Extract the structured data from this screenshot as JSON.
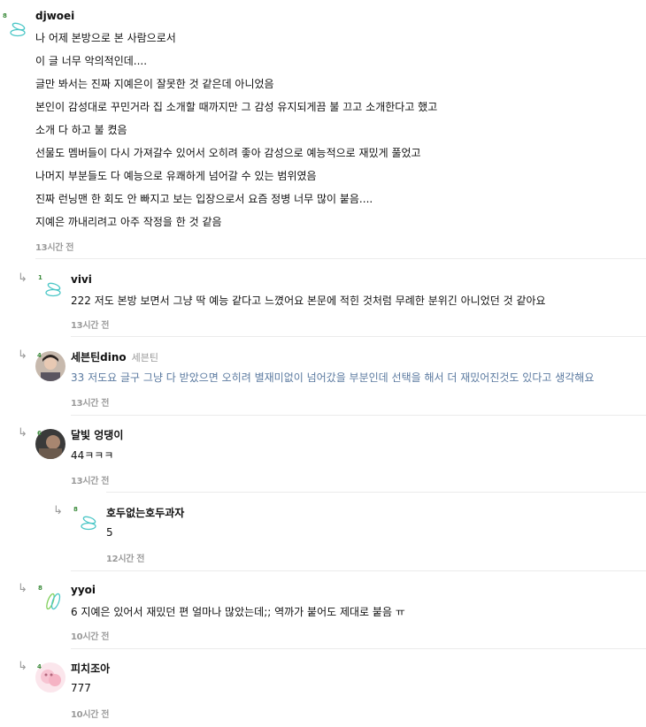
{
  "comments": [
    {
      "nickname": "djwoei",
      "level": "8",
      "lines": [
        "나 어제 본방으로 본 사람으로서",
        "이 글 너무 악의적인데....",
        "글만 봐서는 진짜 지예은이 잘못한 것 같은데 아니었음",
        "본인이 감성대로 꾸민거라 집 소개할 때까지만 그 감성 유지되게끔 불 끄고 소개한다고 했고",
        "소개 다 하고 불 켰음",
        "선물도 멤버들이 다시 가져갈수 있어서 오히려 좋아 감성으로 예능적으로 재밌게 풀었고",
        "나머지 부분들도 다 예능으로 유쾌하게 넘어갈 수 있는 범위였음",
        "진짜 런닝맨 한 회도 안 빠지고 보는 입장으로서 요즘 정병 너무 많이 붙음....",
        "지예은 까내리려고 아주 작정을 한 것 같음"
      ],
      "time": "13시간 전"
    },
    {
      "nickname": "vivi",
      "level": "1",
      "text": "222 저도 본방 보면서 그냥 딱 예능 같다고 느꼈어요 본문에 적힌 것처럼 무례한 분위긴 아니었던 것 같아요",
      "time": "13시간 전"
    },
    {
      "nickname": "세븐틴dino",
      "sub_label": "세븐틴",
      "level": "4",
      "text": "33 저도요 글구 그냥 다 받았으면 오히려 별재미없이 넘어갔을 부분인데 선택을 해서 더 재밌어진것도 있다고 생각해요",
      "time": "13시간 전"
    },
    {
      "nickname": "달빛 엉댕이",
      "level": "6",
      "text": "44ㅋㅋㅋ",
      "time": "13시간 전"
    },
    {
      "nickname": "호두없는호두과자",
      "level": "8",
      "text": "5",
      "time": "12시간 전"
    },
    {
      "nickname": "yyoi",
      "level": "8",
      "text": "6 지예은 있어서 재밌던 편 얼마나 많았는데;; 역까가 붙어도 제대로 붙음 ㅠ",
      "time": "10시간 전"
    },
    {
      "nickname": "피치조아",
      "level": "4",
      "text": "777",
      "time": "10시간 전"
    }
  ],
  "icons": {
    "reply_arrow": "reply-arrow-icon",
    "default_avatar": "default-avatar-icon"
  },
  "colors": {
    "level_badge": "#3a8a3a",
    "reply_text_blue": "#5b7aa0",
    "time_text": "#9a9a9a",
    "avatar_ring": "#4cc7c7"
  }
}
